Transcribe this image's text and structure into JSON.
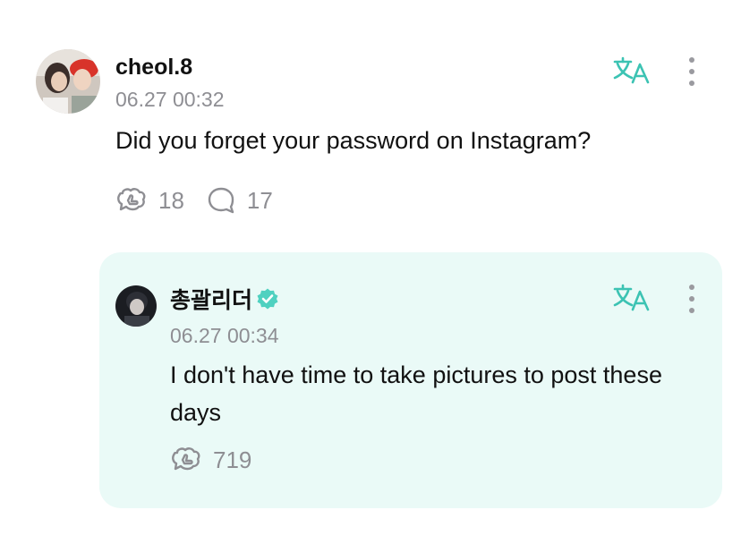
{
  "colors": {
    "accent_teal": "#3cc3b3",
    "verified": "#4fd1c0",
    "muted": "#8e8e93",
    "reply_bg": "#eafaf7"
  },
  "post": {
    "author": "cheol.8",
    "timestamp": "06.27 00:32",
    "text": "Did you forget your password on Instagram?",
    "like_count": "18",
    "comment_count": "17",
    "translate_icon": "translate-icon",
    "more_icon": "more-vertical-icon"
  },
  "reply": {
    "author": "총괄리더",
    "verified": true,
    "timestamp": "06.27 00:34",
    "text": "I don't have time to take pictures to post these days",
    "like_count": "719",
    "translate_icon": "translate-icon",
    "more_icon": "more-vertical-icon"
  }
}
